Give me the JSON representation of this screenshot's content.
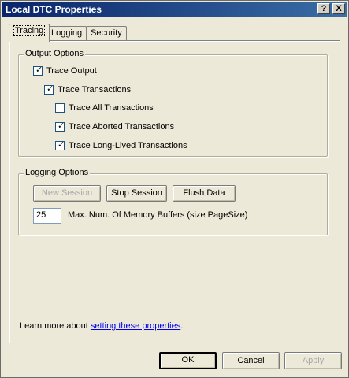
{
  "window": {
    "title": "Local DTC Properties",
    "help_label": "?",
    "close_label": "X"
  },
  "tabs": [
    {
      "label": "Tracing"
    },
    {
      "label": "Logging"
    },
    {
      "label": "Security"
    }
  ],
  "output_options": {
    "legend": "Output Options",
    "items": [
      {
        "label": "Trace Output",
        "checked": true
      },
      {
        "label": "Trace Transactions",
        "checked": true
      },
      {
        "label": "Trace All Transactions",
        "checked": false
      },
      {
        "label": "Trace Aborted Transactions",
        "checked": true
      },
      {
        "label": "Trace Long-Lived Transactions",
        "checked": true
      }
    ]
  },
  "logging_options": {
    "legend": "Logging Options",
    "new_session_label": "New Session",
    "stop_session_label": "Stop Session",
    "flush_data_label": "Flush Data",
    "buffers_value": "25",
    "buffers_label": "Max. Num. Of Memory Buffers (size PageSize)"
  },
  "footer": {
    "learn_more_prefix": "Learn more about ",
    "learn_more_link": "setting these properties",
    "learn_more_suffix": "."
  },
  "dialog_buttons": {
    "ok_label": "OK",
    "cancel_label": "Cancel",
    "apply_label": "Apply"
  },
  "colors": {
    "titlebar_start": "#0a246a",
    "titlebar_end": "#3a6ea5",
    "face": "#ece9d8",
    "link": "#0000ee"
  }
}
